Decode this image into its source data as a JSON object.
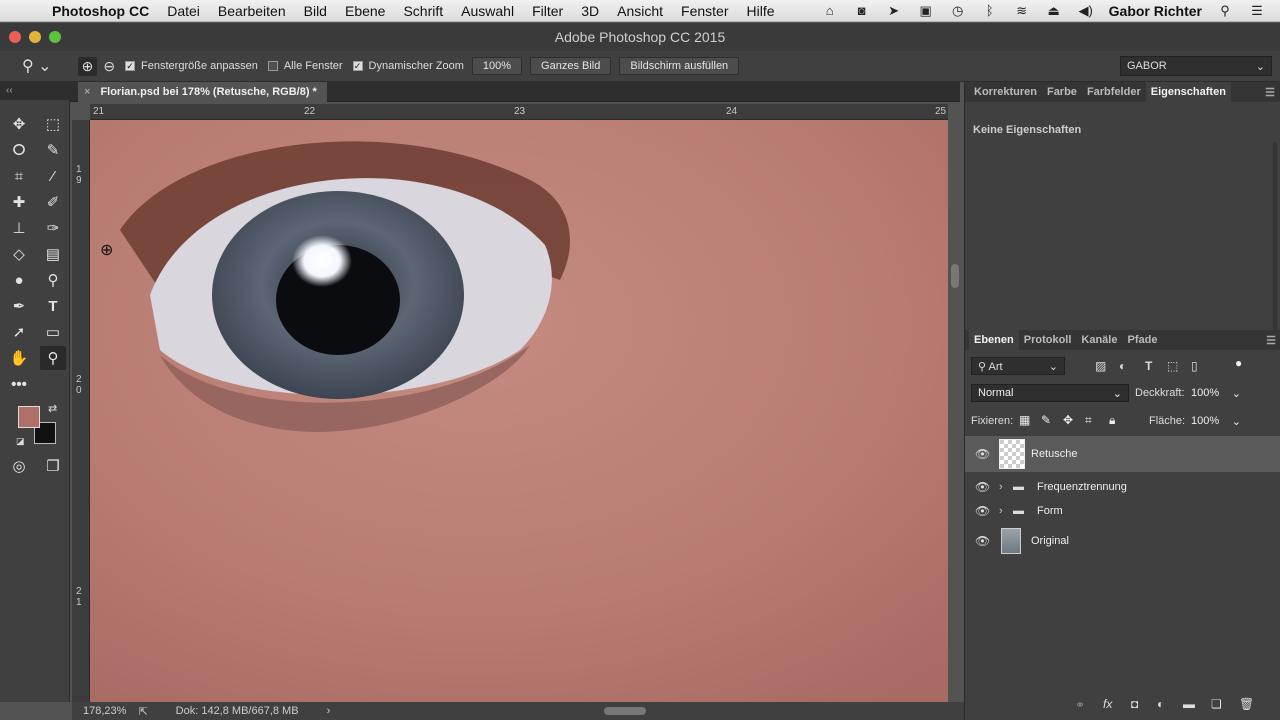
{
  "menubar": {
    "app": "Photoshop CC",
    "items": [
      "Datei",
      "Bearbeiten",
      "Bild",
      "Ebene",
      "Schrift",
      "Auswahl",
      "Filter",
      "3D",
      "Ansicht",
      "Fenster",
      "Hilfe"
    ],
    "user": "Gabor Richter"
  },
  "window": {
    "title": "Adobe Photoshop CC 2015"
  },
  "options": {
    "fit_window": "Fenstergröße anpassen",
    "all_windows": "Alle Fenster",
    "scrubby_zoom": "Dynamischer Zoom",
    "zoom_value": "100%",
    "fit_screen": "Ganzes Bild",
    "fill_screen": "Bildschirm ausfüllen",
    "workspace": "GABOR"
  },
  "document": {
    "tab": "Florian.psd bei 178% (Retusche, RGB/8) *"
  },
  "rulers": {
    "h": [
      "21",
      "22",
      "23",
      "24",
      "25"
    ],
    "v": [
      "1",
      "9",
      "2",
      "0",
      "2",
      "1"
    ]
  },
  "status": {
    "zoom": "178,23%",
    "doc": "Dok: 142,8 MB/667,8 MB"
  },
  "properties_panel": {
    "tabs": [
      "Korrekturen",
      "Farbe",
      "Farbfelder",
      "Eigenschaften"
    ],
    "empty": "Keine Eigenschaften"
  },
  "layers_panel": {
    "tabs": [
      "Ebenen",
      "Protokoll",
      "Kanäle",
      "Pfade"
    ],
    "filter": "Art",
    "blend_mode": "Normal",
    "opacity_label": "Deckkraft:",
    "opacity": "100%",
    "lock_label": "Fixieren:",
    "fill_label": "Fläche:",
    "fill": "100%",
    "layers": [
      {
        "name": "Retusche",
        "kind": "pixel",
        "selected": true
      },
      {
        "name": "Frequenztrennung",
        "kind": "group"
      },
      {
        "name": "Form",
        "kind": "group"
      },
      {
        "name": "Original",
        "kind": "smart"
      }
    ]
  },
  "colors": {
    "foreground": "#b0706a",
    "background": "#111111",
    "accent": "#5a5a5a"
  }
}
